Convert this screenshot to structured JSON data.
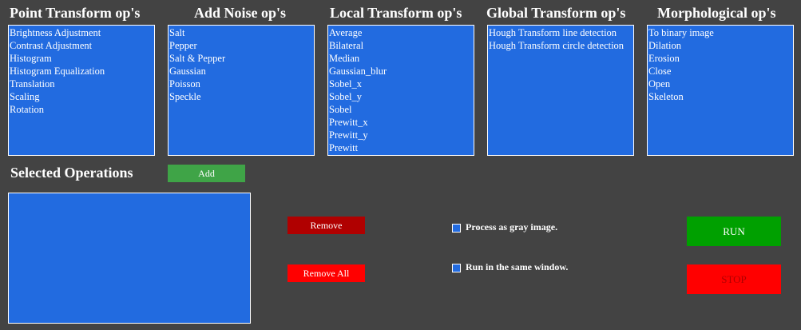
{
  "columns": [
    {
      "heading": "Point Transform op's",
      "items": [
        "Brightness Adjustment",
        "Contrast Adjustment",
        "Histogram",
        "Histogram Equalization",
        "Translation",
        "Scaling",
        "Rotation"
      ]
    },
    {
      "heading": "Add Noise op's",
      "items": [
        "Salt",
        "Pepper",
        "Salt & Pepper",
        "Gaussian",
        "Poisson",
        "Speckle"
      ]
    },
    {
      "heading": "Local Transform op's",
      "items": [
        "Average",
        "Bilateral",
        "Median",
        "Gaussian_blur",
        "Sobel_x",
        "Sobel_y",
        "Sobel",
        "Prewitt_x",
        "Prewitt_y",
        "Prewitt"
      ]
    },
    {
      "heading": "Global Transform op's",
      "items": [
        "Hough Transform line detection",
        "Hough Transform circle detection"
      ]
    },
    {
      "heading": "Morphological op's",
      "items": [
        "To binary image",
        "Dilation",
        "Erosion",
        "Close",
        "Open",
        "Skeleton"
      ]
    }
  ],
  "selected": {
    "heading": "Selected Operations",
    "items": []
  },
  "buttons": {
    "add": "Add",
    "remove": "Remove",
    "remove_all": "Remove All",
    "run": "RUN",
    "stop": "STOP"
  },
  "options": {
    "gray_label": "Process as gray image.",
    "same_window_label": "Run in the same window."
  },
  "colors": {
    "background": "#434343",
    "list": "#226be0",
    "add": "#3fa447",
    "remove": "#b00000",
    "remove_all": "#ff0000",
    "run": "#00a000",
    "stop": "#ff0000"
  }
}
